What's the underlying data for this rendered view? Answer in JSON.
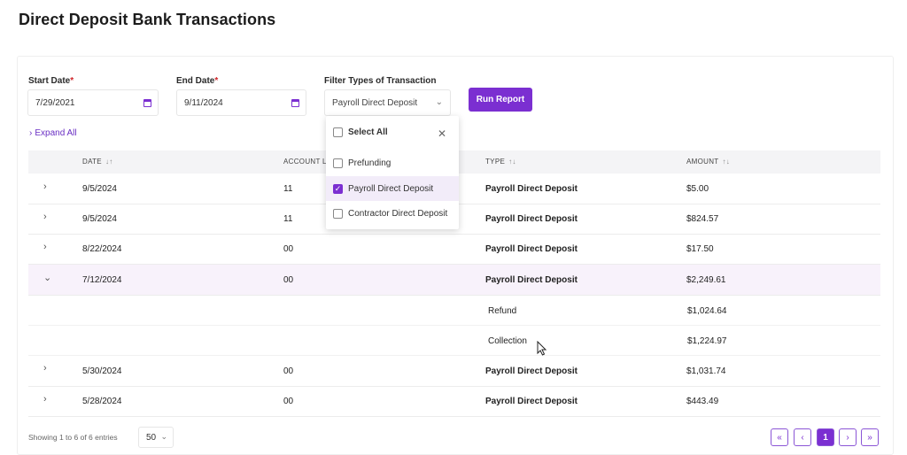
{
  "page": {
    "title": "Direct Deposit Bank Transactions"
  },
  "filters": {
    "start_date_label": "Start Date",
    "start_date_value": "7/29/2021",
    "end_date_label": "End Date",
    "end_date_value": "9/11/2024",
    "required_mark": "*",
    "type_label": "Filter Types of Transaction",
    "type_value": "Payroll Direct Deposit",
    "run_label": "Run Report",
    "expand_all": "Expand All"
  },
  "dropdown": {
    "select_all": "Select All",
    "options": [
      {
        "label": "Prefunding",
        "checked": false
      },
      {
        "label": "Payroll Direct Deposit",
        "checked": true
      },
      {
        "label": "Contractor Direct Deposit",
        "checked": false
      }
    ]
  },
  "table": {
    "columns": {
      "date": "DATE",
      "account": "ACCOUNT LA",
      "type": "TYPE",
      "amount": "AMOUNT"
    },
    "rows": [
      {
        "date": "9/5/2024",
        "account": "11",
        "type": "Payroll Direct Deposit",
        "amount": "$5.00"
      },
      {
        "date": "9/5/2024",
        "account": "11",
        "type": "Payroll Direct Deposit",
        "amount": "$824.57"
      },
      {
        "date": "8/22/2024",
        "account": "00",
        "type": "Payroll Direct Deposit",
        "amount": "$17.50"
      },
      {
        "date": "7/12/2024",
        "account": "00",
        "type": "Payroll Direct Deposit",
        "amount": "$2,249.61"
      },
      {
        "date": "5/30/2024",
        "account": "00",
        "type": "Payroll Direct Deposit",
        "amount": "$1,031.74"
      },
      {
        "date": "5/28/2024",
        "account": "00",
        "type": "Payroll Direct Deposit",
        "amount": "$443.49"
      }
    ],
    "sub_rows": [
      {
        "label": "Refund",
        "amount": "$1,024.64"
      },
      {
        "label": "Collection",
        "amount": "$1,224.97"
      }
    ]
  },
  "footer": {
    "showing": "Showing 1 to 6 of 6 entries",
    "page_size": "50",
    "first": "«",
    "prev": "‹",
    "current_page": "1",
    "next": "›",
    "last": "»"
  },
  "colors": {
    "accent": "#7b2fd1",
    "expanded_row": "#f8f2fb",
    "header_bg": "#f4f4f6"
  }
}
